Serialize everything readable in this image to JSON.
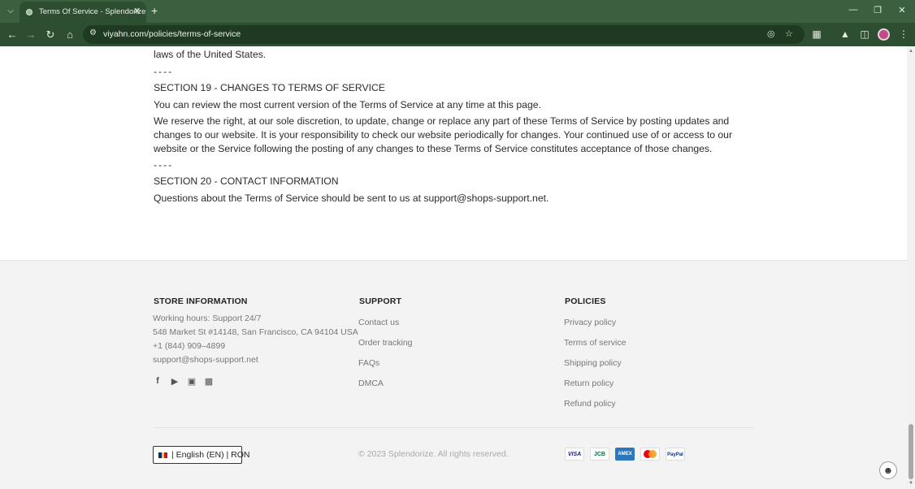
{
  "browser": {
    "tab_title": "Terms Of Service - Splendorize",
    "url": "viyahn.com/policies/terms-of-service"
  },
  "content": {
    "line_top": "laws of the United States.",
    "sep1": "----",
    "section19_title": "SECTION 19 - CHANGES TO TERMS OF SERVICE",
    "section19_p1": "You can review the most current version of the Terms of Service at any time at this page.",
    "section19_p2": "We reserve the right, at our sole discretion, to update, change or replace any part of these Terms of Service by posting updates and changes to our website. It is your responsibility to check our website periodically for changes. Your continued use of or access to our website or the Service following the posting of any changes to these Terms of Service constitutes acceptance of those changes.",
    "sep2": "----",
    "section20_title": "SECTION 20 - CONTACT INFORMATION",
    "section20_p1": "Questions about the Terms of Service should be sent to us at support@shops-support.net."
  },
  "footer": {
    "store": {
      "title": "STORE INFORMATION",
      "hours": "Working hours: Support 24/7",
      "address": "548 Market St #14148, San Francisco, CA 94104 USA",
      "phone": "+1 (844) 909–4899",
      "email": "support@shops-support.net"
    },
    "support": {
      "title": "SUPPORT",
      "links": [
        "Contact us",
        "Order tracking",
        "FAQs",
        "DMCA"
      ]
    },
    "policies": {
      "title": "POLICIES",
      "links": [
        "Privacy policy",
        "Terms of service",
        "Shipping policy",
        "Return policy",
        "Refund policy"
      ]
    },
    "language": "| English (EN) | RON",
    "copyright": "© 2023 Splendorize. All rights reserved.",
    "payments": [
      "VISA",
      "JCB",
      "AMEX",
      "MC",
      "PayPal"
    ]
  },
  "colors": {
    "chrome_dark": "#2e4e32",
    "chrome_tabbar": "#3b5f3f",
    "footer_bg": "#f3f3f3"
  }
}
